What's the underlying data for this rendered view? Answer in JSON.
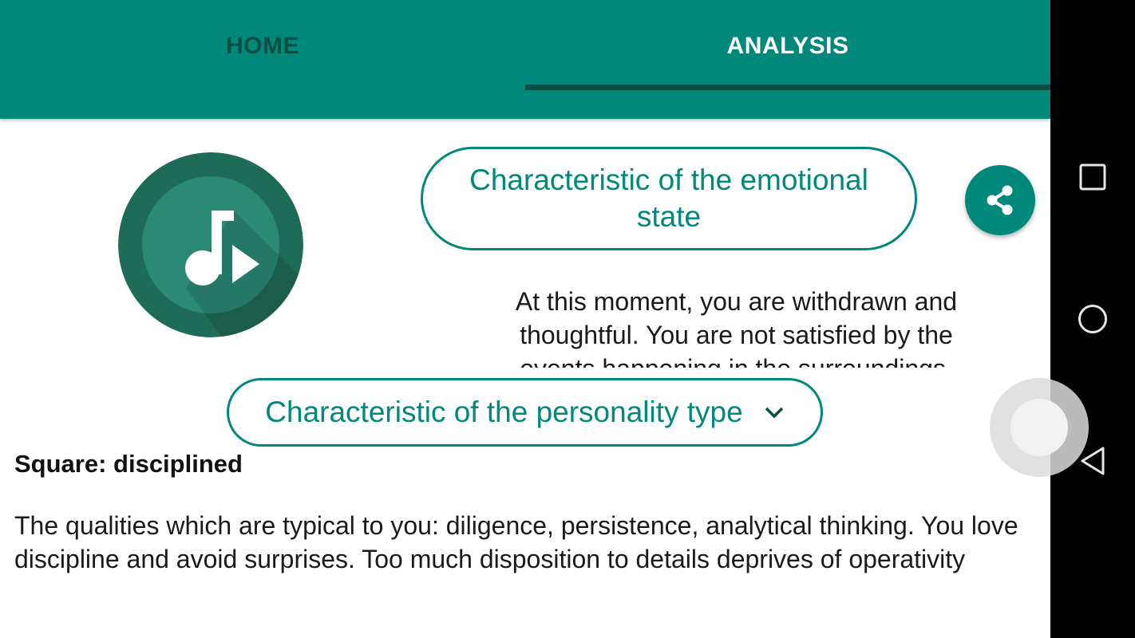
{
  "tabs": {
    "home_label": "HOME",
    "analysis_label": "ANALYSIS",
    "active": "ANALYSIS"
  },
  "emotional": {
    "button_label": "Characteristic of the emotional state",
    "text": "At this moment, you are withdrawn and thoughtful. You are not satisfied by the events happening in the surroundings."
  },
  "personality": {
    "dropdown_label": "Characteristic of the personality type",
    "type_title": "Square: disciplined",
    "description": "The qualities which are typical to you: diligence, persistence, analytical thinking. You love discipline and avoid surprises. Too much disposition to details deprives of operativity"
  },
  "icons": {
    "logo": "music-play-icon",
    "share": "share-icon",
    "chevron": "chevron-down-icon",
    "nav_recent": "square-icon",
    "nav_home": "circle-icon",
    "nav_back": "triangle-back-icon"
  },
  "colors": {
    "primary": "#00897b",
    "tab_inactive": "#0b4e46",
    "logo_outer": "#1e6b57",
    "logo_inner": "#2b8a74"
  }
}
